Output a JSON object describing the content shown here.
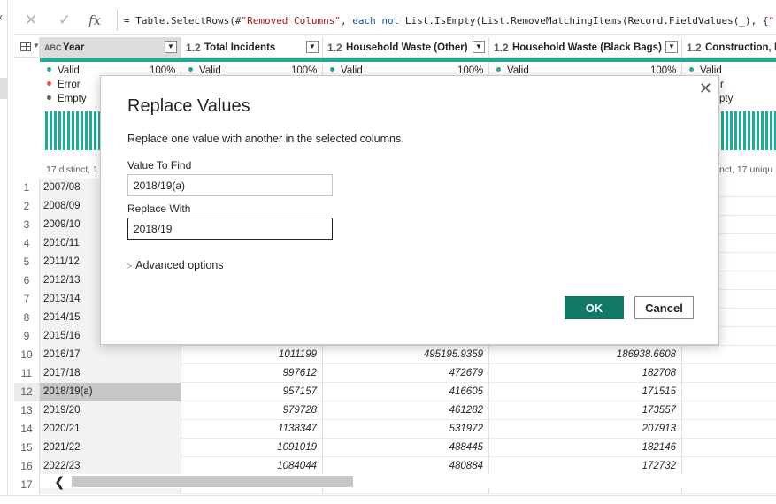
{
  "formula_bar": {
    "cancel_icon": "close-icon",
    "commit_icon": "check-icon",
    "fx_label": "fx",
    "formula_prefix": "= Table.SelectRows(#",
    "formula_str1": "\"Removed Columns\"",
    "formula_mid1": ", ",
    "formula_kw1": "each",
    "formula_mid2": " ",
    "formula_kw2": "not",
    "formula_rest": " List.IsEmpty(List.RemoveMatchingItems(Record.FieldValues(_), {",
    "formula_str2": "\"\""
  },
  "columns": [
    {
      "type": "ABC",
      "name": "Year"
    },
    {
      "type": "1.2",
      "name": "Total Incidents"
    },
    {
      "type": "1.2",
      "name": "Household Waste (Other)"
    },
    {
      "type": "1.2",
      "name": "Household Waste (Black Bags)"
    },
    {
      "type": "1.2",
      "name": "Construction, De"
    }
  ],
  "profile": {
    "valid_label": "Valid",
    "error_label": "Error",
    "empty_label": "Empty",
    "pct": "100%",
    "year_distinct": "17 distinct, 1",
    "last_distinct": "nct, 17 uniqu",
    "last_error_fragment": "r",
    "last_empty_fragment": "pty",
    "colors": {
      "valid": "#1faa9a",
      "error": "#e8524f",
      "empty": "#605e5c"
    }
  },
  "rows": [
    {
      "n": "1",
      "year": "2007/08",
      "total": "",
      "other": "",
      "black": ""
    },
    {
      "n": "2",
      "year": "2008/09",
      "total": "",
      "other": "",
      "black": ""
    },
    {
      "n": "3",
      "year": "2009/10",
      "total": "",
      "other": "",
      "black": ""
    },
    {
      "n": "4",
      "year": "2010/11",
      "total": "",
      "other": "",
      "black": ""
    },
    {
      "n": "5",
      "year": "2011/12",
      "total": "",
      "other": "",
      "black": ""
    },
    {
      "n": "6",
      "year": "2012/13",
      "total": "",
      "other": "",
      "black": ""
    },
    {
      "n": "7",
      "year": "2013/14",
      "total": "",
      "other": "",
      "black": ""
    },
    {
      "n": "8",
      "year": "2014/15",
      "total": "",
      "other": "",
      "black": ""
    },
    {
      "n": "9",
      "year": "2015/16",
      "total": "",
      "other": "",
      "black": ""
    },
    {
      "n": "10",
      "year": "2016/17",
      "total": "1011199",
      "other": "495195.9359",
      "black": "186938.6608"
    },
    {
      "n": "11",
      "year": "2017/18",
      "total": "997612",
      "other": "472679",
      "black": "182708"
    },
    {
      "n": "12",
      "year": "2018/19(a)",
      "total": "957157",
      "other": "416605",
      "black": "171515"
    },
    {
      "n": "13",
      "year": "2019/20",
      "total": "979728",
      "other": "461282",
      "black": "173557"
    },
    {
      "n": "14",
      "year": "2020/21",
      "total": "1138347",
      "other": "531972",
      "black": "207913"
    },
    {
      "n": "15",
      "year": "2021/22",
      "total": "1091019",
      "other": "488445",
      "black": "182146"
    },
    {
      "n": "16",
      "year": "2022/23",
      "total": "1084044",
      "other": "480884",
      "black": "172732"
    },
    {
      "n": "17",
      "year": "",
      "total": "",
      "other": "",
      "black": ""
    }
  ],
  "dialog": {
    "title": "Replace Values",
    "description": "Replace one value with another in the selected columns.",
    "find_label": "Value To Find",
    "find_value": "2018/19(a)",
    "replace_label": "Replace With",
    "replace_value": "2018/19",
    "advanced_label": "Advanced options",
    "ok_label": "OK",
    "cancel_label": "Cancel",
    "close_icon": "close-icon",
    "accent": "#117865"
  }
}
